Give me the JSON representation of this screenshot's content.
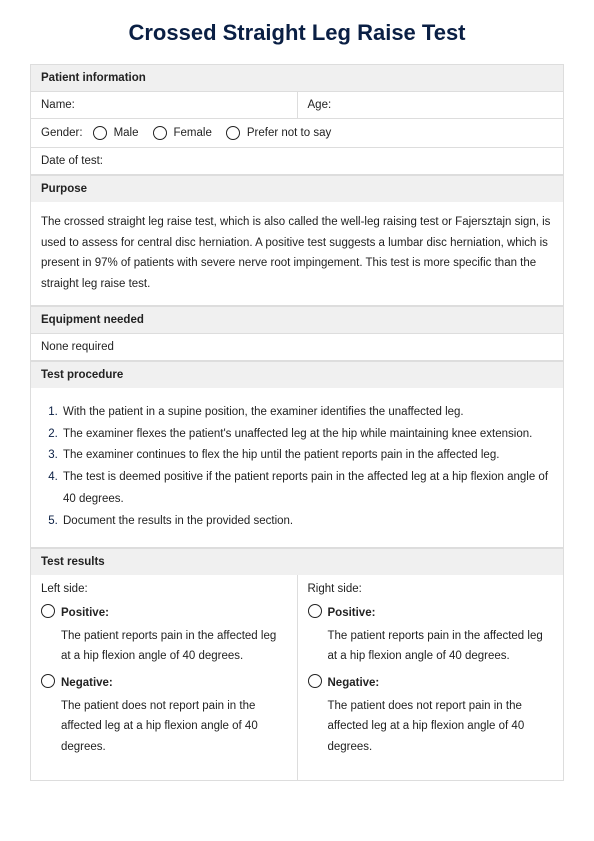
{
  "title": "Crossed Straight Leg Raise Test",
  "sections": {
    "patient_info": {
      "header": "Patient information",
      "name_label": "Name:",
      "age_label": "Age:",
      "gender_label": "Gender:",
      "gender_options": {
        "male": "Male",
        "female": "Female",
        "na": "Prefer not to say"
      },
      "date_label": "Date of test:"
    },
    "purpose": {
      "header": "Purpose",
      "text": "The crossed straight leg raise test, which is also called the well-leg raising test or Fajersztajn sign, is used to assess for central disc herniation. A positive test suggests a lumbar disc herniation, which is present in 97% of patients with severe nerve root impingement. This test is more specific than the straight leg raise test."
    },
    "equipment": {
      "header": "Equipment needed",
      "text": "None required"
    },
    "procedure": {
      "header": "Test procedure",
      "steps": [
        "With the patient in a supine position, the examiner identifies the unaffected leg.",
        "The examiner flexes the patient's unaffected leg at the hip while maintaining knee extension.",
        "The examiner continues to flex the hip until the patient reports pain in the affected leg.",
        "The test is deemed positive if the patient reports pain in the affected leg at a hip flexion angle of 40 degrees.",
        "Document the results in the provided section."
      ]
    },
    "results": {
      "header": "Test results",
      "left_label": "Left side:",
      "right_label": "Right side:",
      "positive_label": "Positive:",
      "positive_desc": "The patient reports pain in the affected leg at a hip flexion angle of 40 degrees.",
      "negative_label": "Negative:",
      "negative_desc": "The patient does not report pain in the affected leg at a hip flexion angle of 40 degrees."
    }
  }
}
